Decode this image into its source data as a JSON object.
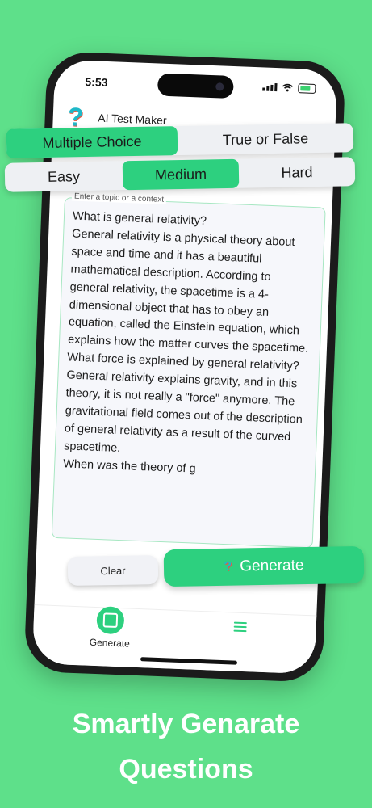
{
  "status_bar": {
    "time": "5:53"
  },
  "app": {
    "title": "AI Test Maker",
    "logo_glyph": "?"
  },
  "question_type": {
    "options": [
      "Multiple Choice",
      "True or False"
    ],
    "selected": "Multiple Choice"
  },
  "difficulty": {
    "options": [
      "Easy",
      "Medium",
      "Hard"
    ],
    "selected": "Medium"
  },
  "topic_input": {
    "label": "Enter a topic or a context",
    "value": "What is general relativity?\nGeneral relativity is a physical theory about space and time and it has a beautiful mathematical description. According to general relativity, the spacetime is a 4-dimensional object that has to obey an equation, called the Einstein equation, which explains how the matter curves the spacetime.\nWhat force is explained by general relativity?\nGeneral relativity explains gravity, and in this theory, it is not really a \"force\" anymore. The gravitational field comes out of the description of general relativity as a result of the curved spacetime.\nWhen was the theory of g"
  },
  "actions": {
    "clear_label": "Clear",
    "generate_label": "Generate"
  },
  "tab_bar": {
    "generate_label": "Generate"
  },
  "headline": {
    "line1": "Smartly Genarate",
    "line2": "Questions"
  },
  "colors": {
    "background": "#5ee08a",
    "accent": "#2dd07f",
    "logo": "#1fb8c8"
  }
}
